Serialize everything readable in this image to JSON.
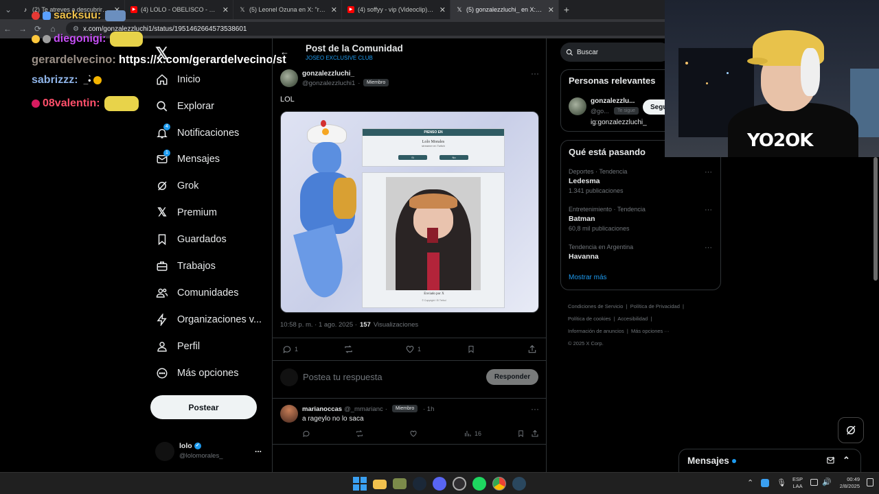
{
  "browser": {
    "tabs": [
      {
        "title": "(2) Te atreves a descubrir lo que",
        "fav": "tiktok"
      },
      {
        "title": "(4) LOLO - OBELISCO - YouTube",
        "fav": "youtube"
      },
      {
        "title": "(5) Leonel Ozuna en X: \"respon",
        "fav": "x"
      },
      {
        "title": "(4) soffyy - vip (Videoclip) - You",
        "fav": "youtube"
      },
      {
        "title": "(5) gonzalezzluchi_ en X: \"LOL\"",
        "fav": "x",
        "active": true
      }
    ],
    "new_tab": "+",
    "url": "x.com/gonzalezzluchi1/status/1951462664573538601"
  },
  "chat_overlay": [
    {
      "user": "sacksuu:",
      "color": "#f0c24b"
    },
    {
      "user": "diegonigi:",
      "color": "#c64ff5"
    },
    {
      "user": "gerardelvecino:",
      "color": "#9a8f86",
      "text": "https://x.com/gerardelvecino/st"
    },
    {
      "user": "sabrizzz:",
      "color": "#8fb4e8",
      "text": "_•̀"
    },
    {
      "user": "08valentin:",
      "color": "#ff4f6a"
    }
  ],
  "nav": {
    "items": [
      {
        "label": "Inicio",
        "icon": "home-icon"
      },
      {
        "label": "Explorar",
        "icon": "search-icon"
      },
      {
        "label": "Notificaciones",
        "icon": "bell-icon",
        "badge": "4"
      },
      {
        "label": "Mensajes",
        "icon": "mail-icon",
        "badge": "1"
      },
      {
        "label": "Grok",
        "icon": "grok-icon"
      },
      {
        "label": "Premium",
        "icon": "x-icon"
      },
      {
        "label": "Guardados",
        "icon": "bookmark-icon"
      },
      {
        "label": "Trabajos",
        "icon": "briefcase-icon"
      },
      {
        "label": "Comunidades",
        "icon": "people-icon"
      },
      {
        "label": "Organizaciones v...",
        "icon": "lightning-icon"
      },
      {
        "label": "Perfil",
        "icon": "person-icon"
      },
      {
        "label": "Más opciones",
        "icon": "more-circle-icon"
      }
    ],
    "post_button": "Postear",
    "account": {
      "name": "lolo",
      "handle": "@lolomorales_",
      "more": "..."
    }
  },
  "header": {
    "title": "Post de la Comunidad",
    "community": "JOSEO EXCLUSIVE CLUB"
  },
  "post": {
    "author": "gonzalezzluchi_",
    "handle": "@gonzalezzluchi1",
    "dot": "·",
    "badge": "Miembro",
    "text": "LOL",
    "image": {
      "header": "PIENSO EN",
      "name": "Lolo Morales",
      "sub": "streamer en Twitch",
      "yes": "Sí",
      "no": "No",
      "footer": "Enviado por X",
      "copyright": "© Copyright / El Trébol"
    },
    "time": "10:58 p. m. · 1 ago. 2025 ·",
    "views_count": "157",
    "views_label": "Visualizaciones",
    "replies": "1",
    "likes": "1"
  },
  "reply_box": {
    "placeholder": "Postea tu respuesta",
    "button": "Responder"
  },
  "reply": {
    "author": "marianoccas",
    "handle": "@_mmarianc",
    "dot": "·",
    "badge": "Miembro",
    "time": "· 1h",
    "text": "a rageylo no lo saca",
    "views": "16"
  },
  "right": {
    "search_placeholder": "Buscar",
    "relevant_title": "Personas relevantes",
    "person": {
      "name": "gonzalezzlu...",
      "handle": "@go...",
      "follows_you": "Te sigue",
      "follow": "Segu",
      "bio": "ig:gonzalezzluchi_"
    },
    "trends_title": "Qué está pasando",
    "trends": [
      {
        "cat": "Deportes · Tendencia",
        "name": "Ledesma",
        "count": "1.341 publicaciones"
      },
      {
        "cat": "Entretenimiento · Tendencia",
        "name": "Batman",
        "count": "60,8 mil publicaciones"
      },
      {
        "cat": "Tendencia en Argentina",
        "name": "Havanna",
        "count": ""
      }
    ],
    "show_more": "Mostrar más",
    "footer": [
      "Condiciones de Servicio",
      "Política de Privacidad",
      "Política de cookies",
      "Accesibilidad",
      "Información de anuncios",
      "Más opciones ···",
      "© 2025 X Corp."
    ]
  },
  "messages_dock": {
    "label": "Mensajes"
  },
  "taskbar": {
    "lang1": "ESP",
    "lang2": "LAA",
    "time": "00:49",
    "date": "2/8/2025"
  },
  "colors": {
    "accent": "#1d9bf0",
    "bg": "#000000",
    "border": "#2f3336"
  }
}
